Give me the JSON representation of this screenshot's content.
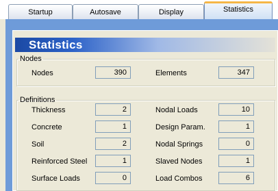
{
  "tabs": [
    {
      "label": "Startup",
      "active": false
    },
    {
      "label": "Autosave",
      "active": false
    },
    {
      "label": "Display",
      "active": false
    },
    {
      "label": "Statistics",
      "active": true
    }
  ],
  "banner": {
    "title": "Statistics"
  },
  "nodes_group": {
    "legend": "Nodes",
    "nodes_label": "Nodes",
    "nodes_value": "390",
    "elements_label": "Elements",
    "elements_value": "347"
  },
  "definitions_group": {
    "legend": "Definitions",
    "left": [
      {
        "label": "Thickness",
        "value": "2"
      },
      {
        "label": "Concrete",
        "value": "1"
      },
      {
        "label": "Soil",
        "value": "2"
      },
      {
        "label": "Reinforced Steel",
        "value": "1"
      },
      {
        "label": "Surface Loads",
        "value": "0"
      }
    ],
    "right": [
      {
        "label": "Nodal Loads",
        "value": "10"
      },
      {
        "label": "Design Param.",
        "value": "1"
      },
      {
        "label": "Nodal Springs",
        "value": "0"
      },
      {
        "label": "Slaved Nodes",
        "value": "1"
      },
      {
        "label": "Load Combos",
        "value": "6"
      }
    ]
  },
  "colors": {
    "accent": "#f5b646",
    "banner_dark": "#1b49a4",
    "panel_blue": "#6e9bd9",
    "dialog_bg": "#ece9d8"
  }
}
